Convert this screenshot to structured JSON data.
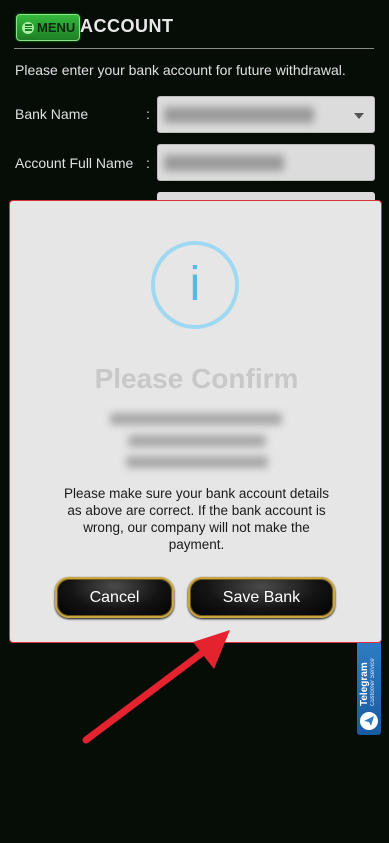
{
  "header": {
    "menu_label": "MENU",
    "title": "ACCOUNT"
  },
  "form": {
    "intro": "Please enter your bank account for future withdrawal.",
    "bank_name_label": "Bank Name",
    "account_full_name_label": "Account Full Name",
    "colon": ":"
  },
  "side_tab": {
    "title": "Telegram",
    "subtitle": "Customer Service"
  },
  "modal": {
    "icon_glyph": "i",
    "title": "Please Confirm",
    "message": "Please make sure your bank account details as above are correct. If the bank account is wrong, our company will not make the payment.",
    "cancel_label": "Cancel",
    "save_label": "Save Bank"
  },
  "colors": {
    "background": "#060d07",
    "modal_bg": "#e6e6e6",
    "modal_border": "#d9323a",
    "info_accent": "#4fbbe8",
    "button_border": "#c9a640",
    "arrow": "#e5232f",
    "menu_green": "#2ea636"
  }
}
